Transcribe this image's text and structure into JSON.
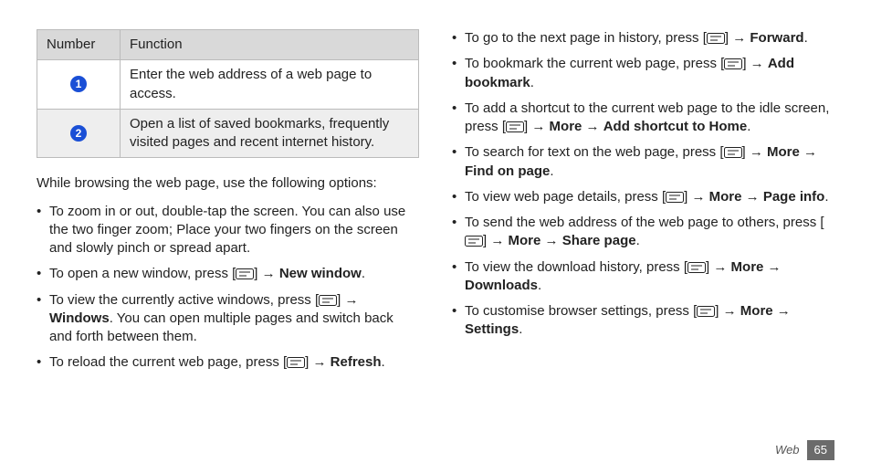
{
  "table": {
    "headers": [
      "Number",
      "Function"
    ],
    "rows": [
      {
        "num": "1",
        "text": "Enter the web address of a web page to access."
      },
      {
        "num": "2",
        "text": "Open a list of saved bookmarks, frequently visited pages and recent internet history."
      }
    ]
  },
  "intro": "While browsing the web page, use the following options:",
  "arrow": " → ",
  "left_items": [
    {
      "pre": "To zoom in or out, double-tap the screen. You can also use the two finger zoom; Place your two fingers on the screen and slowly pinch or spread apart."
    },
    {
      "pre": "To open a new window, press [",
      "icon": true,
      "mid": "]",
      "bold1": "New window",
      "post": "."
    },
    {
      "pre": "To view the currently active windows, press [",
      "icon": true,
      "mid": "] → ",
      "boldInline": "Windows",
      "post2": ". You can open multiple pages and switch back and forth between them.",
      "noArrow": true
    },
    {
      "pre": "To reload the current web page, press [",
      "icon": true,
      "mid": "]",
      "bold1": "Refresh",
      "post": "."
    }
  ],
  "right_items": [
    {
      "pre": "To go to the next page in history, press [",
      "icon": true,
      "mid": "]",
      "bold1": "Forward",
      "post": "."
    },
    {
      "pre": "To bookmark the current web page, press [",
      "icon": true,
      "mid": "]",
      "bold1": "Add bookmark",
      "post": "."
    },
    {
      "pre": "To add a shortcut to the current web page to the idle screen, press [",
      "icon": true,
      "mid": "]",
      "bold1": "More",
      "bold2": "Add shortcut to Home",
      "post": "."
    },
    {
      "pre": "To search for text on the web page, press [",
      "icon": true,
      "mid": "]",
      "bold1": "More",
      "bold2": "Find on page",
      "post": "."
    },
    {
      "pre": "To view web page details, press [",
      "icon": true,
      "mid": "]",
      "bold1": "More",
      "bold2": "Page info",
      "post": "."
    },
    {
      "pre": "To send the web address of the web page to others, press [",
      "icon": true,
      "mid": "]",
      "bold1": "More",
      "bold2": "Share page",
      "post": "."
    },
    {
      "pre": "To view the download history, press [",
      "icon": true,
      "mid": "]",
      "bold1": "More",
      "bold2": "Downloads",
      "post": "."
    },
    {
      "pre": "To customise browser settings, press [",
      "icon": true,
      "mid": "]",
      "bold1": "More",
      "bold2": "Settings",
      "post": "."
    }
  ],
  "footer": {
    "section": "Web",
    "page": "65"
  }
}
